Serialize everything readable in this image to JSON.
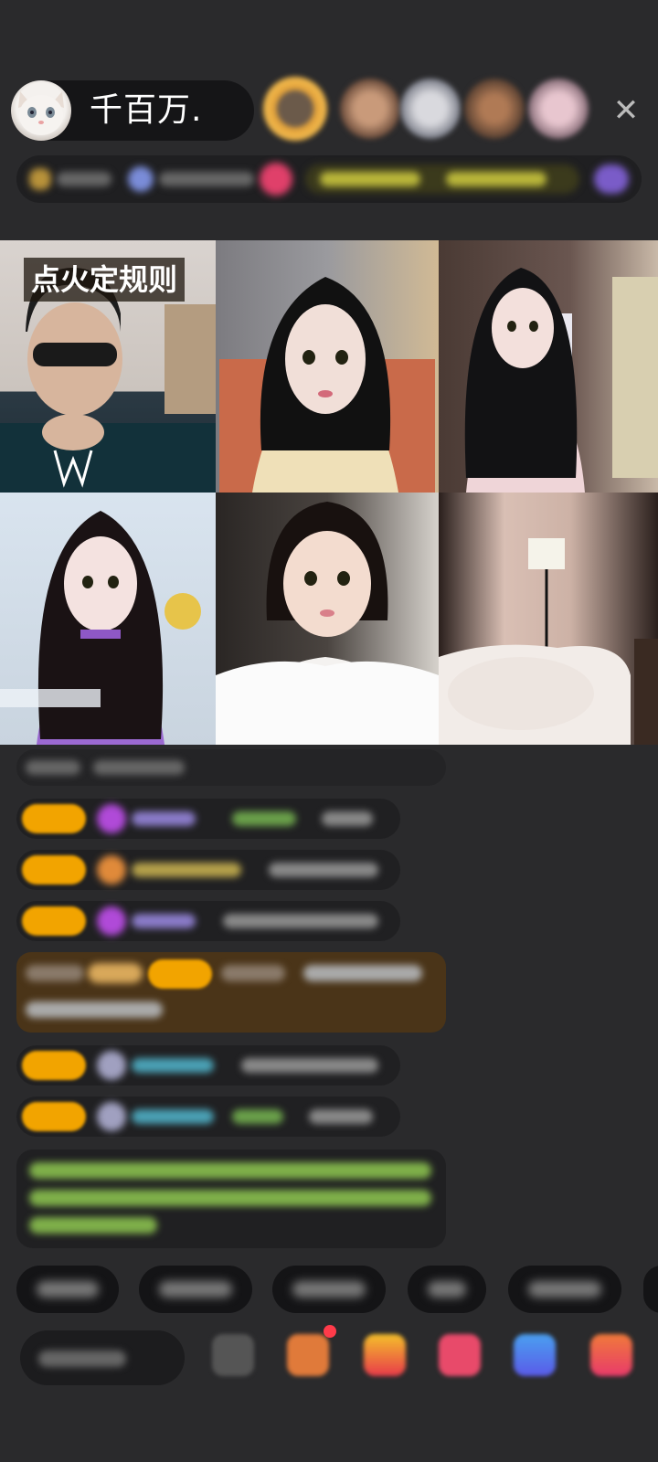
{
  "header": {
    "host_name": "千百万.",
    "avatar_icon": "cat-avatar-icon",
    "close_icon": "close-icon"
  },
  "stream": {
    "title_tag": "点火定规则",
    "tiles": 6
  },
  "colors": {
    "background": "#2a2a2c",
    "badge": "#f2a400",
    "highlight_message": "#4a3418",
    "system_text": "#8bc34a"
  }
}
